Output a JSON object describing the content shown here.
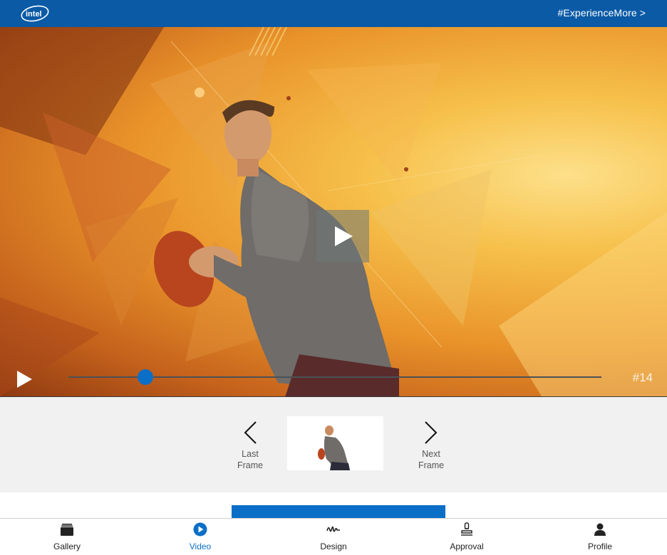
{
  "header": {
    "logo_text": "intel",
    "experience_link": "#ExperienceMore >"
  },
  "player": {
    "frame_label": "#14",
    "progress_fraction": 0.144
  },
  "frame_nav": {
    "prev_label_line1": "Last",
    "prev_label_line2": "Frame",
    "next_label_line1": "Next",
    "next_label_line2": "Frame"
  },
  "bottom_nav": {
    "tabs": [
      {
        "label": "Gallery",
        "icon": "gallery-icon",
        "active": false
      },
      {
        "label": "Video",
        "icon": "play-circle-icon",
        "active": true
      },
      {
        "label": "Design",
        "icon": "signature-icon",
        "active": false
      },
      {
        "label": "Approval",
        "icon": "stamp-icon",
        "active": false
      },
      {
        "label": "Profile",
        "icon": "person-icon",
        "active": false
      }
    ]
  },
  "colors": {
    "brand_blue": "#0a5aa6",
    "accent_blue": "#0b6fc7"
  }
}
